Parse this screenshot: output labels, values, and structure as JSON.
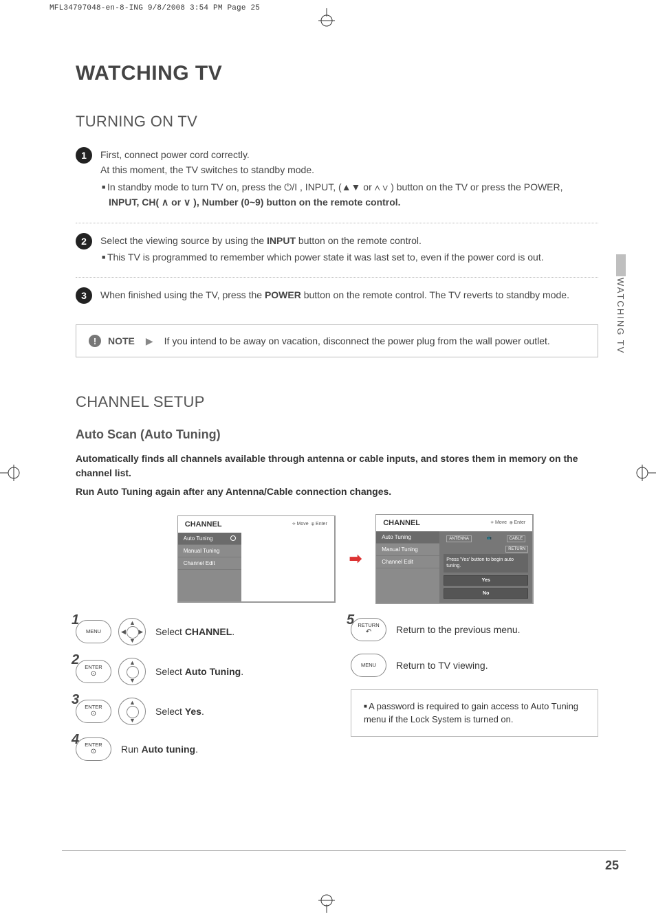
{
  "meta_header": "MFL34797048-en-8-ING  9/8/2008 3:54 PM  Page 25",
  "side_tab": "WATCHING TV",
  "page_number": "25",
  "title": "WATCHING TV",
  "section1": {
    "heading": "TURNING ON TV",
    "step1_a": "First, connect power cord correctly.",
    "step1_b": "At this moment, the TV switches to standby mode.",
    "step1_c_pre": "In standby mode to turn TV on, press the ",
    "step1_c_mid": " , INPUT, (▲▼ or  ∧ ∨ ) button on the TV or press the POWER,",
    "step1_d": "INPUT, CH( ∧  or  ∨ ), Number (0~9) button on the remote control.",
    "step2_a": "Select the viewing source by using the INPUT button on the remote control.",
    "step2_b": "This TV is programmed to remember which power state it was last set to, even if the power cord is out.",
    "step3": "When finished using the TV, press the POWER button on the remote control. The TV reverts to standby mode.",
    "note_label": "NOTE",
    "note_text": "If you intend to be away on vacation, disconnect the power plug from the wall power outlet."
  },
  "section2": {
    "heading": "CHANNEL SETUP",
    "sub_heading": "Auto Scan (Auto Tuning)",
    "para1": "Automatically finds all channels available through antenna or cable inputs, and stores them in memory on the channel list.",
    "para2": "Run Auto Tuning again after any Antenna/Cable connection changes."
  },
  "osd": {
    "title": "CHANNEL",
    "hint_move": "Move",
    "hint_enter": "Enter",
    "items": [
      "Auto Tuning",
      "Manual Tuning",
      "Channel Edit"
    ],
    "right_antenna": "ANTENNA",
    "right_cable": "CABLE",
    "right_return": "RETURN",
    "prompt": "Press 'Yes' button to begin auto tuning.",
    "yes": "Yes",
    "no": "No"
  },
  "remote": {
    "btn_menu": "MENU",
    "btn_enter": "ENTER",
    "btn_return": "RETURN",
    "step1": "Select CHANNEL.",
    "step2": "Select Auto Tuning.",
    "step3": "Select Yes.",
    "step4": "Run Auto tuning.",
    "step5": "Return to the previous menu.",
    "step6": "Return to TV viewing.",
    "info": "A password is required to gain access to Auto Tuning menu if the Lock System is turned on."
  }
}
